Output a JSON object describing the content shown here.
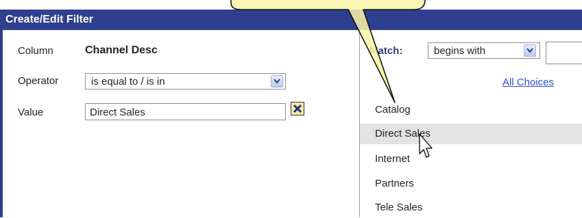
{
  "dialog": {
    "title": "Create/Edit Filter"
  },
  "form": {
    "column_label": "Column",
    "column_value": "Channel Desc",
    "operator_label": "Operator",
    "operator_value": "is equal to / is in",
    "value_label": "Value",
    "value_text": "Direct Sales"
  },
  "match": {
    "label": "Match:",
    "mode": "begins with",
    "search_value": ""
  },
  "all_choices_link": "All Choices",
  "choices": [
    {
      "label": "Catalog"
    },
    {
      "label": "Direct Sales"
    },
    {
      "label": "Internet"
    },
    {
      "label": "Partners"
    },
    {
      "label": "Tele Sales"
    }
  ],
  "highlighted_choice": "Direct Sales",
  "colors": {
    "header": "#2f3f8f",
    "highlight_row": "#e3e3e3",
    "link": "#2a4bd6",
    "callout": "#fbf5a8"
  }
}
